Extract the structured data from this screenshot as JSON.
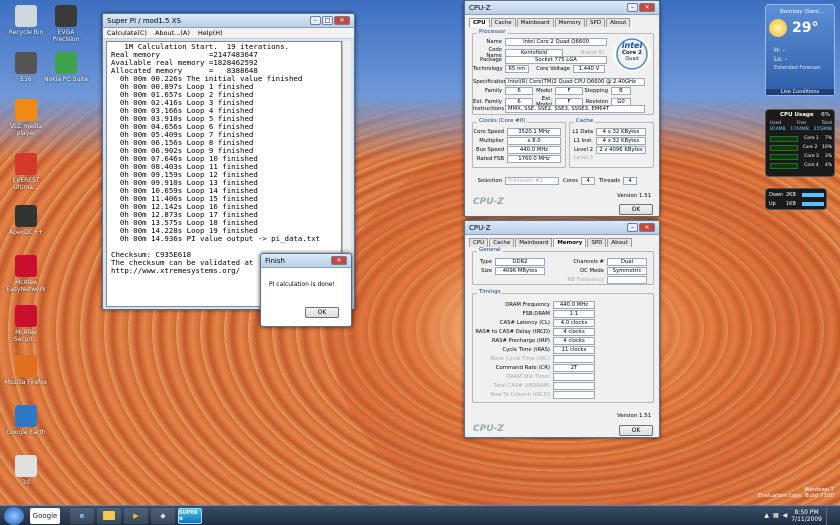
{
  "desktop_icons": [
    {
      "label": "Recycle Bin",
      "icon": "recycle-bin-icon"
    },
    {
      "label": "EVGA Precision",
      "icon": "evga-icon"
    },
    {
      "label": "E16",
      "icon": "e16-icon"
    },
    {
      "label": "Nokia PC Suite",
      "icon": "nokia-icon"
    },
    {
      "label": "VLC media player",
      "icon": "vlc-icon"
    },
    {
      "label": "EVEREST Ultima...",
      "icon": "everest-icon"
    },
    {
      "label": "ApexDC++",
      "icon": "apexdc-icon"
    },
    {
      "label": "McAfee EasyNetwork",
      "icon": "mcafee-icon"
    },
    {
      "label": "McAfee Securi...",
      "icon": "mcafee-security-icon"
    },
    {
      "label": "Mozilla Firefox",
      "icon": "firefox-icon"
    },
    {
      "label": "Google Earth",
      "icon": "google-earth-icon"
    },
    {
      "label": "3d",
      "icon": "file-icon"
    }
  ],
  "superpi": {
    "title": "Super PI / mod1.5 XS",
    "menu": [
      "Calculate(C)",
      "About...(A)",
      "Help(H)"
    ],
    "lines": [
      "   1M Calculation Start.  19 iterations.",
      "Real memory           =2147483647",
      "Available real memory =1828462592",
      "Allocated memory      =   8388648",
      "  0h 00m 00.226s The initial value finished",
      "  0h 00m 00.897s Loop 1 finished",
      "  0h 00m 01.657s Loop 2 finished",
      "  0h 00m 02.416s Loop 3 finished",
      "  0h 00m 03.166s Loop 4 finished",
      "  0h 00m 03.910s Loop 5 finished",
      "  0h 00m 04.656s Loop 6 finished",
      "  0h 00m 05.409s Loop 7 finished",
      "  0h 00m 06.156s Loop 8 finished",
      "  0h 00m 06.902s Loop 9 finished",
      "  0h 00m 07.646s Loop 10 finished",
      "  0h 00m 08.403s Loop 11 finished",
      "  0h 00m 09.159s Loop 12 finished",
      "  0h 00m 09.910s Loop 13 finished",
      "  0h 00m 10.659s Loop 14 finished",
      "  0h 00m 11.406s Loop 15 finished",
      "  0h 00m 12.142s Loop 16 finished",
      "  0h 00m 12.873s Loop 17 finished",
      "  0h 00m 13.575s Loop 18 finished",
      "  0h 00m 14.228s Loop 19 finished",
      "  0h 00m 14.936s PI value output -> pi_data.txt",
      "",
      "Checksum: C935E618",
      "The checksum can be validated at",
      "http://www.xtremesystems.org/"
    ]
  },
  "finish_dialog": {
    "title": "Finish",
    "message": "PI calculation is done!",
    "ok": "OK"
  },
  "cpuz1": {
    "title": "CPU-Z",
    "tabs": [
      "CPU",
      "Cache",
      "Mainboard",
      "Memory",
      "SPD",
      "About"
    ],
    "processor_label": "Processor",
    "name_l": "Name",
    "name": "Intel Core 2 Quad Q6600",
    "code_l": "Code Name",
    "code": "Kentsfield",
    "brand_l": "Brand ID",
    "package_l": "Package",
    "package": "Socket 775 LGA",
    "tech_l": "Technology",
    "tech": "65 nm",
    "cv_l": "Core Voltage",
    "cv": "1.440 V",
    "spec_l": "Specification",
    "spec": "Intel(R) Core(TM)2 Quad CPU    Q6600 @ 2.40GHz",
    "family_l": "Family",
    "family": "6",
    "model_l": "Model",
    "model": "F",
    "stepping_l": "Stepping",
    "stepping": "B",
    "extfam_l": "Ext. Family",
    "extfam": "6",
    "extmod_l": "Ext. Model",
    "extmod": "F",
    "rev_l": "Revision",
    "rev": "G0",
    "instr_l": "Instructions",
    "instr": "MMX, SSE, SSE2, SSE3, SSSE3, EM64T",
    "intel_logo": "intel",
    "intel_sub": "Core 2",
    "intel_sub2": "Quad",
    "clocks_label": "Clocks (Core #0)",
    "cs_l": "Core Speed",
    "cs": "3520.1 MHz",
    "mul_l": "Multiplier",
    "mul": "x 8.0",
    "bus_l": "Bus Speed",
    "bus": "440.0 MHz",
    "fsb_l": "Rated FSB",
    "fsb": "1760.0 MHz",
    "cache_label": "Cache",
    "l1d_l": "L1 Data",
    "l1d": "4 x 32 KBytes",
    "l1i_l": "L1 Inst.",
    "l1i": "4 x 32 KBytes",
    "l2_l": "Level 2",
    "l2": "2 x 4096 KBytes",
    "l3_l": "Level 3",
    "sel_l": "Selection",
    "sel": "Processor #1",
    "cores_l": "Cores",
    "cores": "4",
    "threads_l": "Threads",
    "threads": "4",
    "logo": "CPU-Z",
    "version": "Version 1.51",
    "ok": "OK"
  },
  "cpuz2": {
    "title": "CPU-Z",
    "tabs": [
      "CPU",
      "Cache",
      "Mainboard",
      "Memory",
      "SPD",
      "About"
    ],
    "general_label": "General",
    "type_l": "Type",
    "type": "DDR2",
    "ch_l": "Channels #",
    "ch": "Dual",
    "size_l": "Size",
    "size": "4096 MBytes",
    "dc_l": "DC Mode",
    "dc": "Symmetric",
    "nb_l": "NB Frequency",
    "timings_label": "Timings",
    "t": [
      {
        "l": "DRAM Frequency",
        "v": "440.0 MHz",
        "dim": false
      },
      {
        "l": "FSB:DRAM",
        "v": "1:1",
        "dim": false
      },
      {
        "l": "CAS# Latency (CL)",
        "v": "4.0 clocks",
        "dim": false
      },
      {
        "l": "RAS# to CAS# Delay (tRCD)",
        "v": "4 clocks",
        "dim": false
      },
      {
        "l": "RAS# Precharge (tRP)",
        "v": "4 clocks",
        "dim": false
      },
      {
        "l": "Cycle Time (tRAS)",
        "v": "11 clocks",
        "dim": false
      },
      {
        "l": "Bank Cycle Time (tRC)",
        "v": "",
        "dim": true
      },
      {
        "l": "Command Rate (CR)",
        "v": "2T",
        "dim": false
      },
      {
        "l": "DRAM Idle Timer",
        "v": "",
        "dim": true
      },
      {
        "l": "Total CAS# (tRDRAM)",
        "v": "",
        "dim": true
      },
      {
        "l": "Row To Column (tRCD)",
        "v": "",
        "dim": true
      }
    ],
    "logo": "CPU-Z",
    "version": "Version 1.51",
    "ok": "OK"
  },
  "weather": {
    "location": "Bombay (Sant...",
    "temp": "29°",
    "hi": "H: -",
    "lo": "Lo: -",
    "forecast": "Extended Forecast",
    "link": "Live Conditions"
  },
  "cpu_gadget": {
    "title": "CPU Usage",
    "pct": "6%",
    "h1": "Used",
    "h2": "Free",
    "h3": "Total",
    "r1": [
      "814MB",
      "1744MB",
      "2558MB"
    ],
    "cores": [
      "Core 1",
      "Core 2",
      "Core 3",
      "Core 4"
    ],
    "core_pct": [
      "7%",
      "10%",
      "3%",
      "4%"
    ]
  },
  "net_gadget": {
    "down": "Down",
    "up": "Up",
    "down_v": "2KB",
    "up_v": "1KB"
  },
  "tray": {
    "time": "8:50 PM",
    "date": "7/11/2009",
    "os": "Windows 7",
    "build": "Evaluation copy. Build 7100"
  },
  "taskbar": {
    "google": "Google",
    "superpi": "SUPER π"
  }
}
